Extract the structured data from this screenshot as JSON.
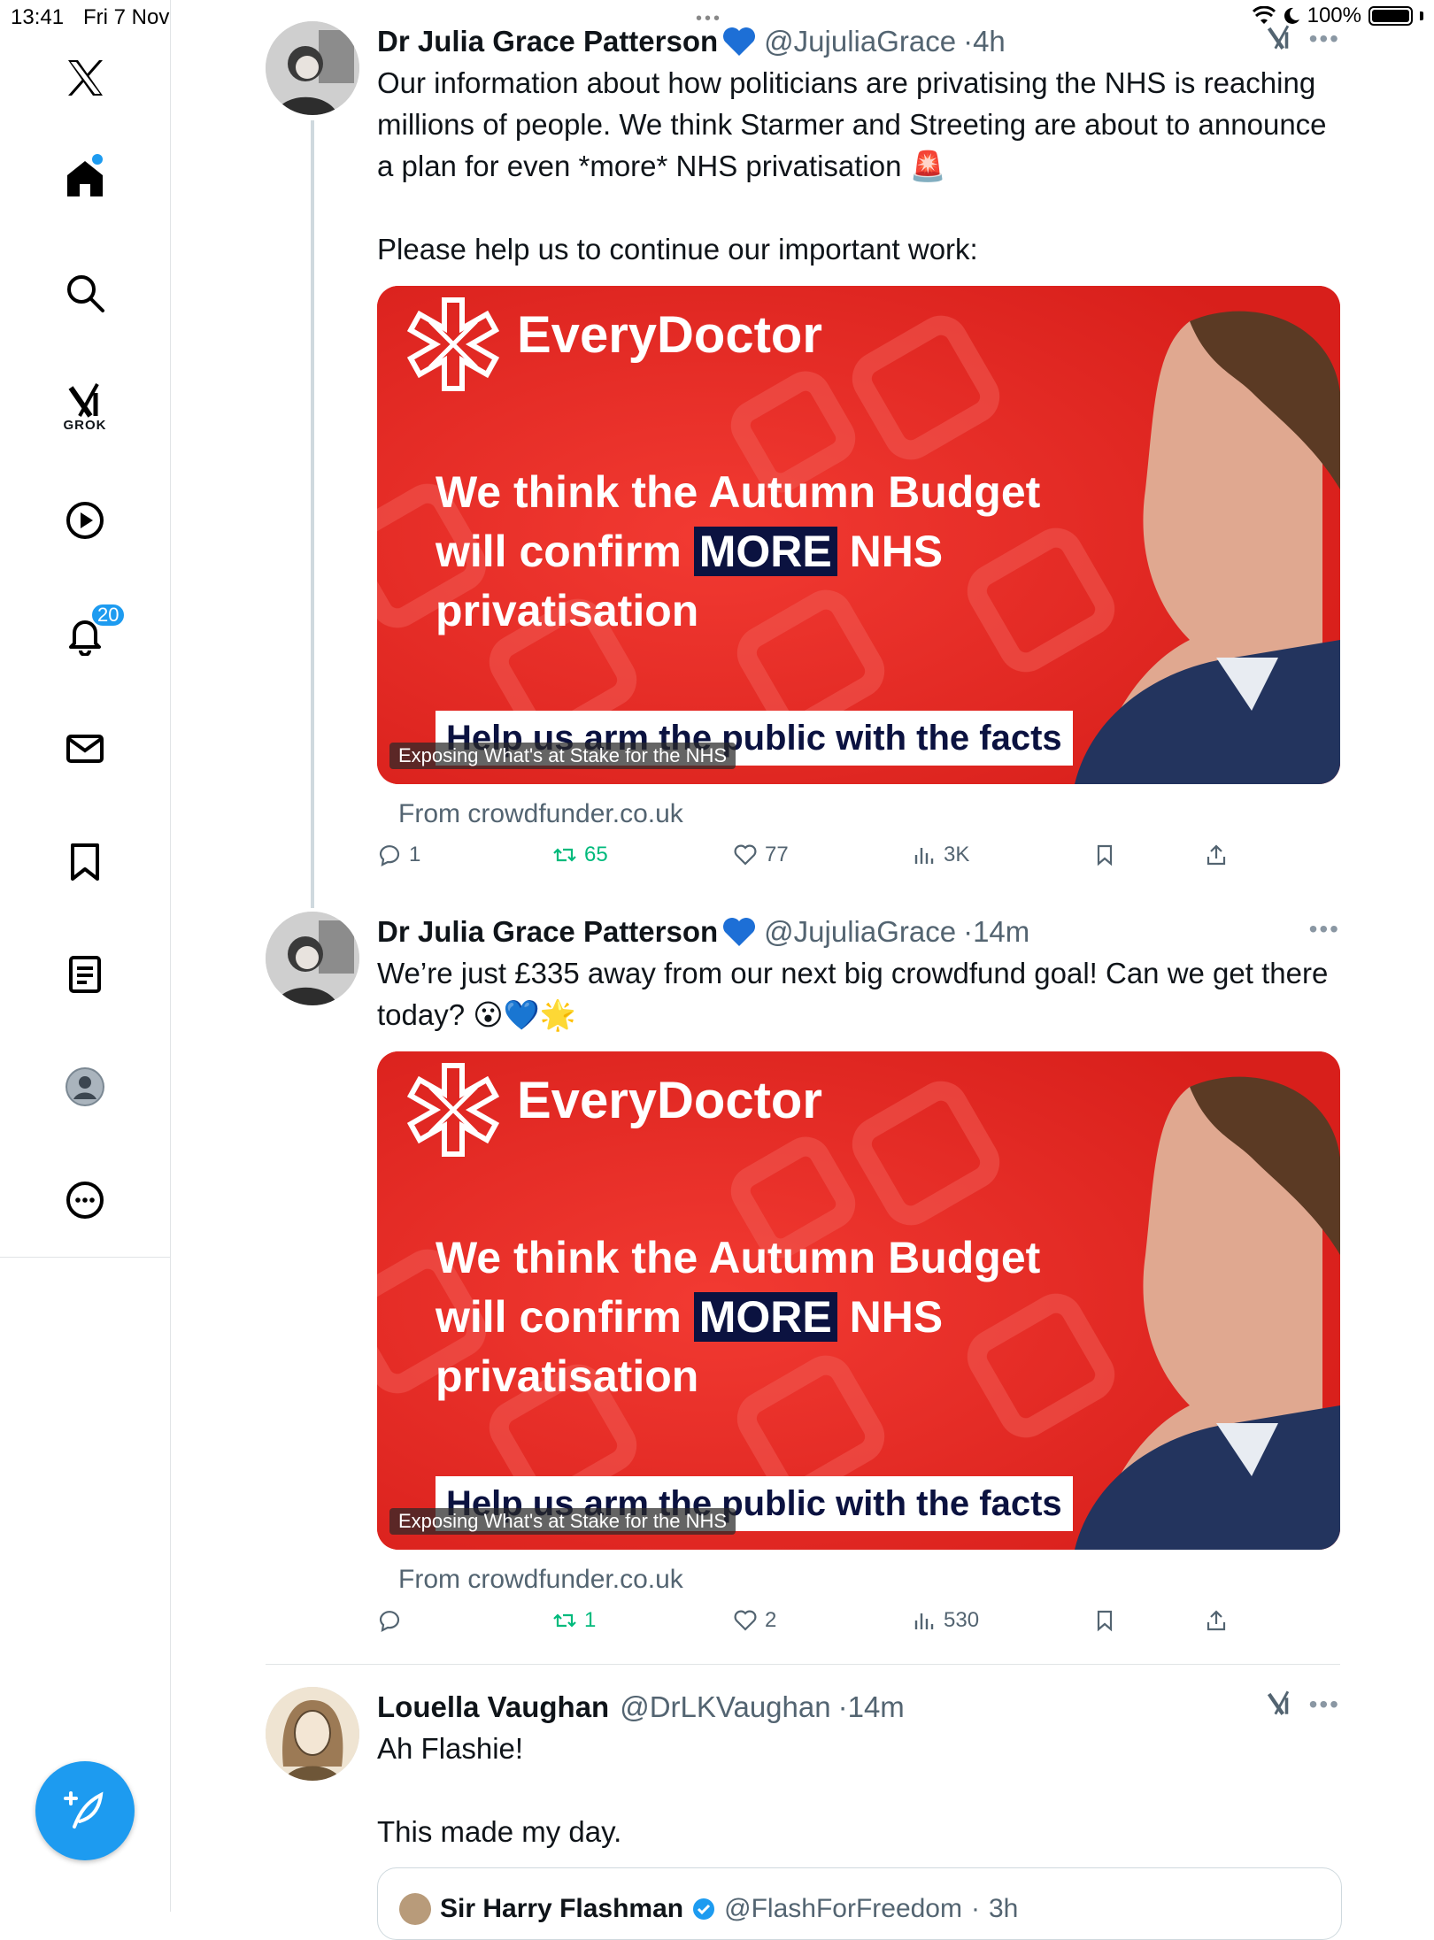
{
  "status_bar": {
    "time": "13:41",
    "date": "Fri 7 Nov",
    "battery": "100%"
  },
  "sidebar": {
    "items": [
      {
        "name": "x-logo",
        "label": ""
      },
      {
        "name": "home",
        "label": ""
      },
      {
        "name": "search",
        "label": ""
      },
      {
        "name": "grok",
        "label": "GROK"
      },
      {
        "name": "video",
        "label": ""
      },
      {
        "name": "notifications",
        "label": "",
        "badge": "20"
      },
      {
        "name": "messages",
        "label": ""
      },
      {
        "name": "bookmarks",
        "label": ""
      },
      {
        "name": "lists",
        "label": ""
      },
      {
        "name": "profile",
        "label": ""
      },
      {
        "name": "more",
        "label": ""
      }
    ]
  },
  "tweets": [
    {
      "name": "Dr Julia Grace Patterson",
      "handle": "@JujuliaGrace",
      "time": "4h",
      "text": "Our information about how politicians are privatising the NHS is reaching millions of people. We think Starmer and Streeting are about to announce a plan for even *more* NHS privatisation 🚨\n\nPlease help us to continue our important work:",
      "card": {
        "brand": "EveryDoctor",
        "headline_1": "We think the Autumn Budget",
        "headline_2a": "will confirm ",
        "headline_more": "MORE",
        "headline_2b": " NHS",
        "headline_3": "privatisation",
        "cta": "Help us arm the public with the facts",
        "caption": "Exposing What's at Stake for the NHS",
        "source": "From crowdfunder.co.uk"
      },
      "replies": "1",
      "reposts": "65",
      "likes": "77",
      "views": "3K"
    },
    {
      "name": "Dr Julia Grace Patterson",
      "handle": "@JujuliaGrace",
      "time": "14m",
      "text": "We’re just £335 away from our next big crowdfund goal! Can we get there today? 😮💙🌟",
      "card": {
        "brand": "EveryDoctor",
        "headline_1": "We think the Autumn Budget",
        "headline_2a": "will confirm ",
        "headline_more": "MORE",
        "headline_2b": " NHS",
        "headline_3": "privatisation",
        "cta": "Help us arm the public with the facts",
        "caption": "Exposing What's at Stake for the NHS",
        "source": "From crowdfunder.co.uk"
      },
      "replies": "",
      "reposts": "1",
      "likes": "2",
      "views": "530"
    },
    {
      "name": "Louella Vaughan",
      "handle": "@DrLKVaughan",
      "time": "14m",
      "text": "Ah Flashie!\n\nThis made my day."
    }
  ],
  "quoted": {
    "name": "Sir Harry Flashman",
    "handle": "@FlashForFreedom",
    "time": "3h"
  },
  "colors": {
    "accent": "#1d9bf0",
    "repost": "#00ba7c",
    "card_red": "#e52520",
    "navy": "#0b1240"
  }
}
